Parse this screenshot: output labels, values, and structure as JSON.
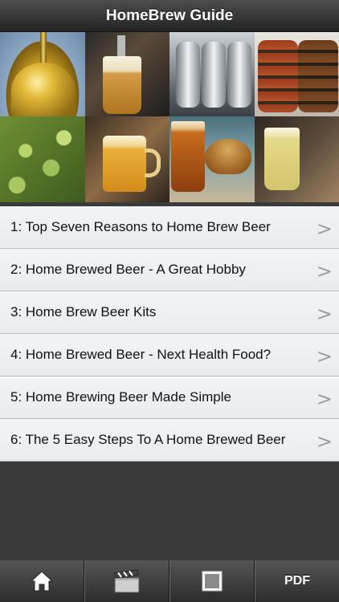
{
  "app": {
    "title": "HomeBrew Guide"
  },
  "banner": {
    "tiles": [
      "kettle-photo",
      "beer-tap-photo",
      "steel-tanks-photo",
      "barrels-photo",
      "hops-photo",
      "beer-mug-photo",
      "beer-bread-photo",
      "pale-beer-photo"
    ]
  },
  "list": {
    "items": [
      {
        "label": "1: Top Seven Reasons to Home Brew Beer",
        "arrow": ">"
      },
      {
        "label": "2: Home Brewed Beer - A Great Hobby",
        "arrow": ">"
      },
      {
        "label": "3: Home Brew Beer Kits",
        "arrow": ">"
      },
      {
        "label": "4: Home Brewed Beer - Next Health Food?",
        "arrow": ">"
      },
      {
        "label": "5: Home Brewing Beer Made Simple",
        "arrow": ">"
      },
      {
        "label": "6: The 5 Easy Steps To A Home Brewed Beer",
        "arrow": ">"
      }
    ]
  },
  "tabbar": {
    "tabs": [
      {
        "icon": "home-icon"
      },
      {
        "icon": "clapperboard-icon"
      },
      {
        "icon": "square-icon"
      },
      {
        "label": "PDF"
      }
    ]
  }
}
